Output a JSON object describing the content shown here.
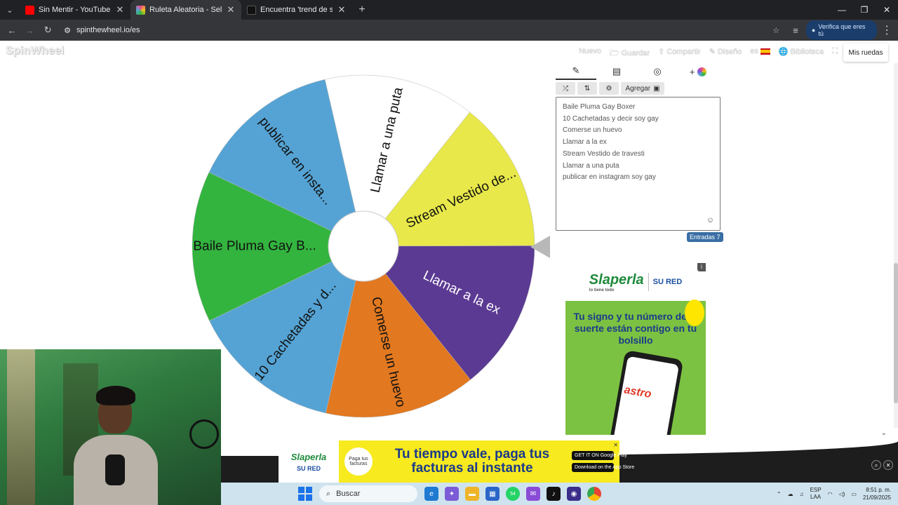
{
  "browser": {
    "tabs": [
      {
        "label": "Sin Mentir - YouTube",
        "icon": "youtube-icon",
        "color": "#ff0000",
        "active": false
      },
      {
        "label": "Ruleta Aleatoria - Selector Pers",
        "icon": "spinwheel-favicon",
        "color": "#e94b8a",
        "active": true
      },
      {
        "label": "Encuentra 'trend de sohan' en T",
        "icon": "tiktok-icon",
        "color": "#111111",
        "active": false
      }
    ],
    "url": "spinthewheel.io/es",
    "verify_label": "Verifica que eres tú"
  },
  "site": {
    "logo": "SpinWheel",
    "nav": {
      "nuevo": "Nuevo",
      "guardar": "Guardar",
      "compartir": "Compartir",
      "diseno": "Diseño",
      "lang": "es",
      "biblioteca": "Biblioteca"
    },
    "mis_ruedas": "Mis ruedas"
  },
  "wheel": {
    "segments": [
      {
        "label": "Llamar a una puta",
        "color": "#ffffff"
      },
      {
        "label": "Stream Vestido de...",
        "color": "#e8e84a"
      },
      {
        "label": "Llamar a la ex",
        "color": "#5b3a93"
      },
      {
        "label": "Comerse un huevo",
        "color": "#e2781f"
      },
      {
        "label": "10 Cachetadas y d...",
        "color": "#55a3d4"
      },
      {
        "label": "Baile Pluma Gay B...",
        "color": "#33b43f"
      },
      {
        "label": "publicar en insta...",
        "color": "#55a3d4"
      }
    ]
  },
  "panel": {
    "tabs": [
      "pencil-icon",
      "clipboard-icon",
      "eye-slash-icon",
      "add-color-icon"
    ],
    "toolbar": {
      "shuffle": "⤮",
      "sort": "⇅",
      "settings": "⚙",
      "add_label": "Agregar"
    },
    "entries": [
      "Baile Pluma Gay Boxer",
      "10 Cachetadas y decir soy gay",
      "Comerse un huevo",
      "Llamar a la ex",
      "Stream Vestido de travesti",
      "Llamar a una puta",
      "publicar en instagram soy gay"
    ],
    "entries_badge": "Entradas 7"
  },
  "ads": {
    "right": {
      "brand": "Slaperla",
      "tagline": "lo tiene todo",
      "partner": "SU RED",
      "copy": "Tu signo y tu número de la suerte están contigo en tu bolsillo",
      "phone_text": "astro"
    },
    "bottom": {
      "brand": "Slaperla",
      "partner": "SU RED",
      "badge": "Paga tus facturas",
      "copy": "Tu tiempo vale, paga tus facturas al instante",
      "store1": "GET IT ON Google Play",
      "store2": "Download on the App Store"
    }
  },
  "taskbar": {
    "search": "Buscar",
    "lang": "ESP",
    "region": "LAA",
    "time": "8:51 p. m.",
    "date": "21/09/2025",
    "badge": "54"
  }
}
